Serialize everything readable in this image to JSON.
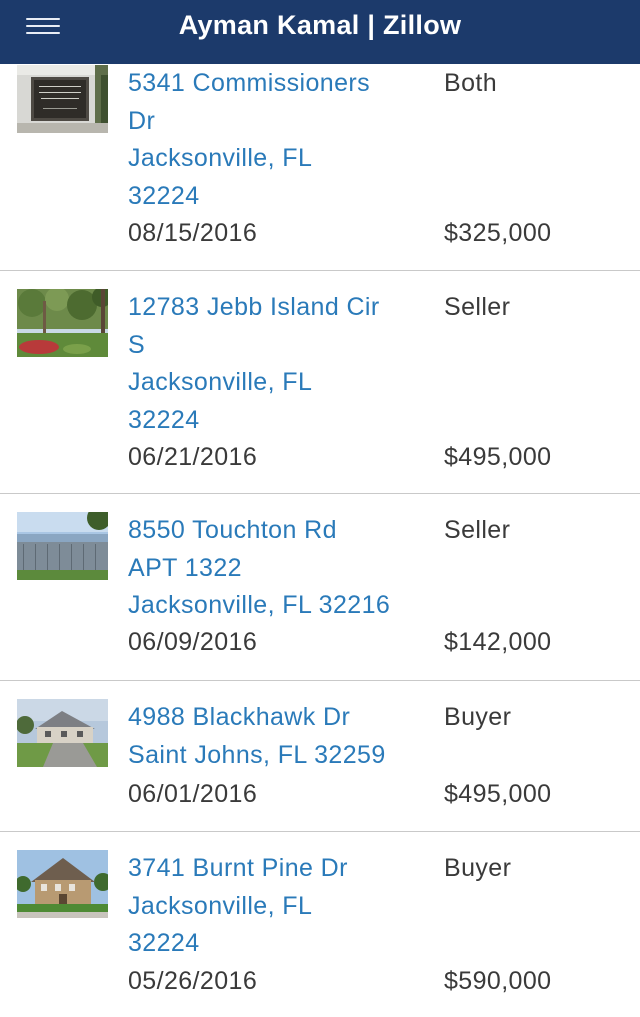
{
  "header": {
    "title": "Ayman Kamal | Zillow",
    "menu_icon": "hamburger-menu-icon",
    "background": "#1c3a6b"
  },
  "colors": {
    "link": "#2a7ab9",
    "text": "#3a3a3a",
    "divider": "#c9c9c9"
  },
  "transactions": [
    {
      "address_lines": [
        "5341 Commissioners",
        "Dr",
        "Jacksonville, FL",
        "32224"
      ],
      "date": "08/15/2016",
      "role": "Both",
      "price": "$325,000",
      "photo": "pablo-creek-sign"
    },
    {
      "address_lines": [
        "12783 Jebb Island Cir",
        "S",
        "Jacksonville, FL",
        "32224"
      ],
      "date": "06/21/2016",
      "role": "Seller",
      "price": "$495,000",
      "photo": "yard-trees"
    },
    {
      "address_lines": [
        "8550 Touchton Rd",
        "APT 1322",
        "Jacksonville, FL 32216"
      ],
      "date": "06/09/2016",
      "role": "Seller",
      "price": "$142,000",
      "photo": "lake-fence"
    },
    {
      "address_lines": [
        "4988 Blackhawk Dr",
        "Saint Johns, FL 32259"
      ],
      "date": "06/01/2016",
      "role": "Buyer",
      "price": "$495,000",
      "photo": "house-driveway"
    },
    {
      "address_lines": [
        "3741 Burnt Pine Dr",
        "Jacksonville, FL",
        "32224"
      ],
      "date": "05/26/2016",
      "role": "Buyer",
      "price": "$590,000",
      "photo": "two-story-house"
    }
  ]
}
